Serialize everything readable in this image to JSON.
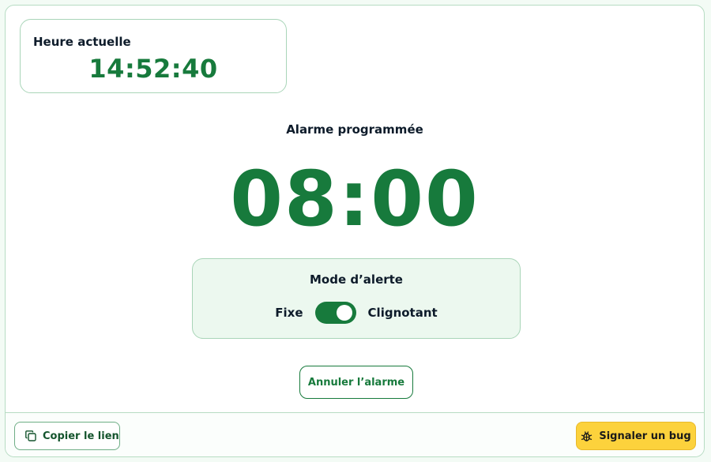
{
  "current": {
    "label": "Heure actuelle",
    "time": "14:52:40"
  },
  "alarm": {
    "label": "Alarme programmée",
    "time": "08:00"
  },
  "mode": {
    "title": "Mode d’alerte",
    "option_off": "Fixe",
    "option_on": "Clignotant",
    "toggle_on": true
  },
  "actions": {
    "cancel_label": "Annuler l’alarme"
  },
  "footer": {
    "copy_label": "Copier le lien",
    "copy_icon": "copy-icon",
    "bug_label": "Signaler un bug",
    "bug_icon": "bug-icon"
  },
  "colors": {
    "accent": "#177a3c",
    "card_bg": "#ecf8ef",
    "bug_button": "#fcd23c"
  }
}
